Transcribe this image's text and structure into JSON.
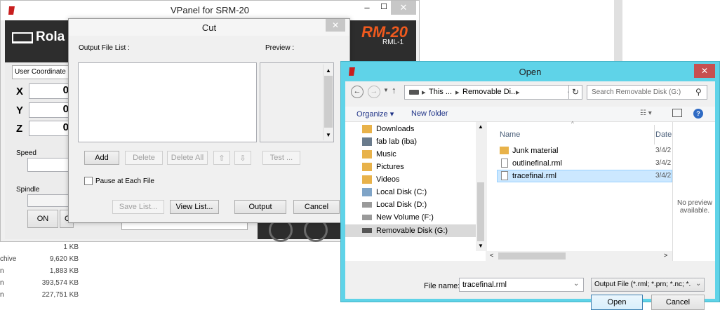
{
  "background_list": {
    "rows": [
      {
        "type": "",
        "size": "1 KB"
      },
      {
        "type": "chive",
        "size": "9,620 KB"
      },
      {
        "type": "n",
        "size": "1,883 KB"
      },
      {
        "type": "n",
        "size": "393,574 KB"
      },
      {
        "type": "n",
        "size": "227,751 KB"
      }
    ]
  },
  "vpanel": {
    "title": "VPanel for SRM-20",
    "brand_text": "Rola",
    "model": "RM-20",
    "model_sub": "RML-1",
    "coord_label": "User Coordinate S",
    "axes": [
      {
        "label": "X",
        "value": "0"
      },
      {
        "label": "Y",
        "value": "0"
      },
      {
        "label": "Z",
        "value": "0"
      }
    ],
    "speed_label": "Speed",
    "spindle_label": "Spindle",
    "on_label": "ON",
    "off_label_partial": "O"
  },
  "cut": {
    "title": "Cut",
    "output_list_label": "Output File List :",
    "preview_label": "Preview :",
    "buttons": {
      "add": "Add",
      "delete": "Delete",
      "delete_all": "Delete All",
      "up": "⇧",
      "down": "⇩",
      "test": "Test ...",
      "save_list": "Save List...",
      "view_list": "View List...",
      "output": "Output",
      "cancel": "Cancel"
    },
    "pause_label": "Pause at Each File"
  },
  "open": {
    "title": "Open",
    "breadcrumb": [
      "This ...",
      "Removable Di...",
      ""
    ],
    "search_placeholder": "Search Removable Disk (G:)",
    "organize_label": "Organize ▾",
    "new_folder_label": "New folder",
    "nav_items": [
      {
        "label": "Downloads",
        "icon": "downloads-icon"
      },
      {
        "label": "fab lab (iba)",
        "icon": "network-icon"
      },
      {
        "label": "Music",
        "icon": "music-icon"
      },
      {
        "label": "Pictures",
        "icon": "pictures-icon"
      },
      {
        "label": "Videos",
        "icon": "videos-icon"
      },
      {
        "label": "Local Disk (C:)",
        "icon": "drive-icon"
      },
      {
        "label": "Local Disk (D:)",
        "icon": "drive-icon"
      },
      {
        "label": "New Volume (F:)",
        "icon": "drive-icon"
      },
      {
        "label": "Removable Disk (G:)",
        "icon": "usb-drive-icon"
      }
    ],
    "columns": {
      "name": "Name",
      "date": "Date"
    },
    "files": [
      {
        "name": "Junk material",
        "date": "3/4/2",
        "type": "folder"
      },
      {
        "name": "outlinefinal.rml",
        "date": "3/4/2",
        "type": "file"
      },
      {
        "name": "tracefinal.rml",
        "date": "3/4/2",
        "type": "file"
      }
    ],
    "no_preview": "No preview available.",
    "file_name_label": "File name:",
    "file_name_value": "tracefinal.rml",
    "filter_value": "Output File (*.rml; *.prn; *.nc; *.",
    "open_button": "Open",
    "cancel_button": "Cancel"
  },
  "colors": {
    "open_titlebar": "#5fd3e8",
    "vpanel_dark": "#2d2d2d",
    "model_orange": "#f05a1e",
    "selected": "#cce8ff"
  }
}
